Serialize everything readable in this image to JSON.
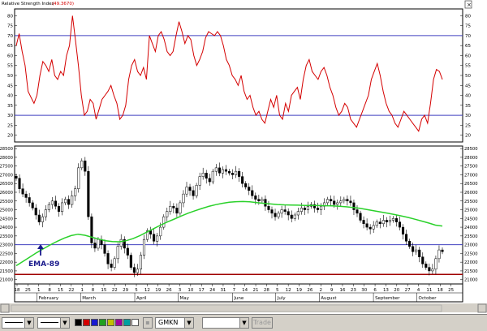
{
  "window": {
    "rsi_title": "Relative Strength Index",
    "rsi_value": "(49.3670)",
    "ema_label": "EMA-89"
  },
  "rsi_axis": {
    "ticks": [
      "80",
      "75",
      "70",
      "65",
      "60",
      "55",
      "50",
      "45",
      "40",
      "35",
      "30",
      "25",
      "20"
    ],
    "levels": [
      70,
      30
    ]
  },
  "price_axis": {
    "ticks": [
      "28500",
      "28000",
      "27500",
      "27000",
      "26500",
      "26000",
      "25500",
      "25000",
      "24500",
      "24000",
      "23500",
      "23000",
      "22500",
      "22000",
      "21500",
      "21000"
    ],
    "support_level": 21300,
    "resistance_level": 23000
  },
  "x_axis": {
    "days": [
      "18",
      "25",
      "1",
      "8",
      "15",
      "22",
      "1",
      "8",
      "15",
      "22",
      "29",
      "5",
      "12",
      "19",
      "26",
      "3",
      "10",
      "17",
      "24",
      "31",
      "7",
      "14",
      "21",
      "28",
      "5",
      "12",
      "19",
      "26",
      "2",
      "9",
      "16",
      "23",
      "30",
      "6",
      "13",
      "20",
      "27",
      "4",
      "11",
      "18",
      "25"
    ],
    "months": [
      "February",
      "March",
      "April",
      "May",
      "June",
      "July",
      "August",
      "September",
      "October"
    ]
  },
  "chart_data": [
    {
      "type": "line",
      "title": "Relative Strength Index",
      "ylim": [
        17,
        83
      ],
      "reference_lines": [
        70,
        30
      ],
      "series": [
        {
          "values": [
            65,
            71,
            62,
            55,
            42,
            39,
            36,
            40,
            50,
            57,
            55,
            52,
            58,
            50,
            48,
            52,
            50,
            60,
            65,
            80,
            68,
            55,
            40,
            30,
            32,
            38,
            36,
            28,
            33,
            38,
            40,
            42,
            45,
            40,
            36,
            28,
            30,
            35,
            48,
            55,
            58,
            52,
            50,
            54,
            48,
            70,
            66,
            62,
            70,
            72,
            68,
            62,
            60,
            62,
            70,
            77,
            72,
            66,
            70,
            68,
            60,
            55,
            58,
            62,
            69,
            72,
            71,
            70,
            72,
            70,
            65,
            58,
            55,
            50,
            48,
            45,
            50,
            42,
            38,
            40,
            34,
            30,
            32,
            28,
            26,
            32,
            38,
            34,
            40,
            30,
            28,
            36,
            32,
            40,
            42,
            44,
            38,
            48,
            55,
            58,
            52,
            50,
            48,
            52,
            54,
            50,
            44,
            40,
            34,
            30,
            32,
            36,
            34,
            28,
            26,
            24,
            28,
            32,
            36,
            40,
            48,
            52,
            56,
            50,
            42,
            36,
            32,
            30,
            26,
            24,
            28,
            32,
            30,
            28,
            26,
            24,
            22,
            28,
            30,
            26,
            36,
            48,
            53,
            52,
            48
          ]
        }
      ]
    },
    {
      "type": "candlestick",
      "ylim": [
        20800,
        28600
      ],
      "reference_lines": [
        23000,
        21300
      ],
      "series": [
        {
          "name": "Price",
          "values": [
            26800,
            26200,
            25900,
            25700,
            25400,
            25100,
            24700,
            24300,
            24600,
            25000,
            25300,
            25500,
            25200,
            24900,
            25400,
            25600,
            25300,
            25800,
            26200,
            27400,
            27800,
            27200,
            24600,
            23100,
            22800,
            23300,
            23000,
            22500,
            21900,
            21700,
            22200,
            22900,
            23300,
            22800,
            22400,
            21700,
            21400,
            21600,
            22400,
            23300,
            23800,
            23600,
            23200,
            23500,
            24000,
            24600,
            24900,
            25200,
            25100,
            24800,
            25400,
            25900,
            26300,
            26100,
            25800,
            26400,
            26900,
            27100,
            26800,
            26600,
            27200,
            27400,
            27100,
            27300,
            27200,
            27100,
            27000,
            27200,
            26900,
            26500,
            26300,
            26100,
            25800,
            25600,
            25500,
            25600,
            25200,
            25000,
            24800,
            24600,
            24800,
            25000,
            24900,
            24700,
            24500,
            24700,
            24900,
            25100,
            25000,
            25200,
            25300,
            25100,
            25000,
            25200,
            25400,
            25600,
            25500,
            25300,
            25400,
            25500,
            25600,
            25500,
            25400,
            25000,
            24800,
            24400,
            24200,
            24000,
            23900,
            24100,
            24300,
            24200,
            24400,
            24300,
            24400,
            24500,
            24300,
            24000,
            23600,
            23200,
            22900,
            22600,
            22700,
            22300,
            21900,
            21700,
            21500,
            21600,
            22200,
            22700,
            22600
          ]
        },
        {
          "name": "EMA-89",
          "values": [
            21800,
            22050,
            22300,
            22550,
            22780,
            23000,
            23200,
            23380,
            23520,
            23600,
            23540,
            23430,
            23320,
            23230,
            23180,
            23170,
            23230,
            23350,
            23520,
            23720,
            23920,
            24120,
            24300,
            24470,
            24640,
            24800,
            24940,
            25070,
            25190,
            25290,
            25370,
            25430,
            25460,
            25470,
            25450,
            25410,
            25370,
            25330,
            25300,
            25280,
            25270,
            25260,
            25250,
            25250,
            25240,
            25230,
            25220,
            25200,
            25170,
            25130,
            25080,
            25010,
            24940,
            24870,
            24800,
            24730,
            24650,
            24560,
            24460,
            24350,
            24240,
            24120,
            24070
          ]
        }
      ]
    }
  ],
  "toolbar": {
    "symbol_value": "GMKN",
    "trade_label": "Trade"
  },
  "colors": {
    "rsi_line": "#d40000",
    "ema_line": "#2ad12a",
    "level_line": "#4040c0",
    "support_line": "#a00000",
    "ema_label": "#1a1a8c"
  },
  "icons": [
    "arrow-up-icon",
    "close-icon",
    "dropdown-arrow-icon"
  ]
}
